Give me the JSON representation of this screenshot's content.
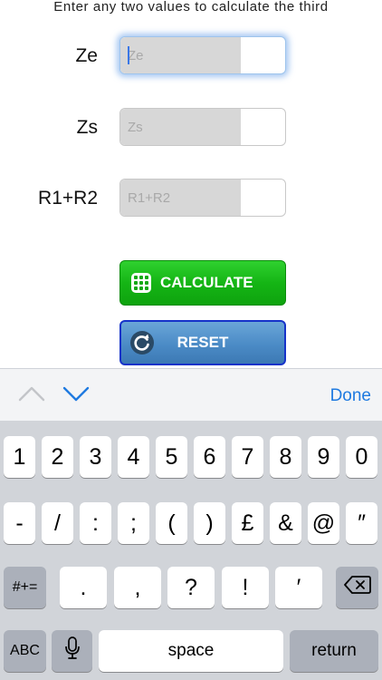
{
  "instruction": "Enter any two values to calculate the third",
  "fields": [
    {
      "label": "Ze",
      "placeholder": "Ze",
      "value": ""
    },
    {
      "label": "Zs",
      "placeholder": "Zs",
      "value": ""
    },
    {
      "label": "R1+R2",
      "placeholder": "R1+R2",
      "value": ""
    }
  ],
  "buttons": {
    "calculate": "CALCULATE",
    "reset": "RESET"
  },
  "accessory": {
    "done": "Done"
  },
  "keyboard": {
    "row1": [
      "1",
      "2",
      "3",
      "4",
      "5",
      "6",
      "7",
      "8",
      "9",
      "0"
    ],
    "row2": [
      "-",
      "/",
      ":",
      ";",
      "(",
      ")",
      "£",
      "&",
      "@",
      "″"
    ],
    "row3": {
      "toggle": "#+=",
      "keys": [
        ".",
        ",",
        "?",
        "!",
        "′"
      ]
    },
    "row4": {
      "abc": "ABC",
      "space": "space",
      "return": "return"
    }
  },
  "colors": {
    "calculate_green": "#15b515",
    "reset_blue": "#4b8bc6",
    "done_blue": "#1f7ae0",
    "keyboard_bg": "#d1d4d9"
  },
  "icons": {
    "calculate": "keypad-grid-icon",
    "reset": "refresh-icon",
    "prev": "chevron-up-icon",
    "next": "chevron-down-icon",
    "delete": "backspace-icon",
    "mic": "microphone-icon"
  }
}
